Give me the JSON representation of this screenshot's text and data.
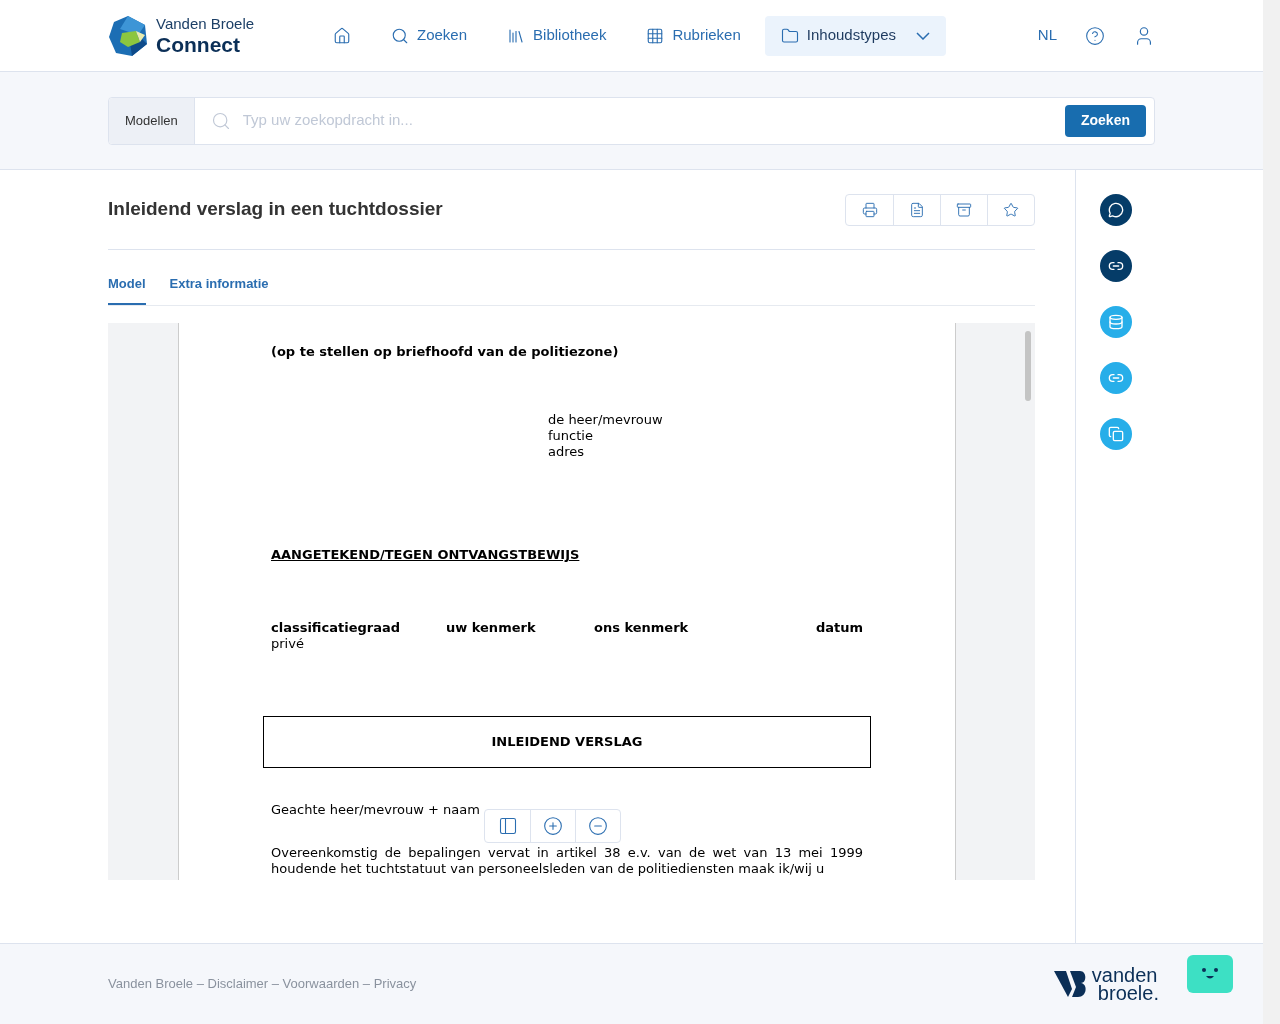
{
  "header": {
    "brand": {
      "line1": "Vanden Broele",
      "line2": "Connect"
    },
    "nav": [
      {
        "kind": "home",
        "selected": false
      },
      {
        "kind": "search",
        "label": "Zoeken",
        "selected": false
      },
      {
        "kind": "library",
        "label": "Bibliotheek",
        "selected": false
      },
      {
        "kind": "grid",
        "label": "Rubrieken",
        "selected": false
      },
      {
        "kind": "folder",
        "label": "Inhoudstypes",
        "selected": true
      }
    ],
    "language": "NL"
  },
  "search": {
    "scope": "Modellen",
    "placeholder": "Typ uw zoekopdracht in...",
    "button": "Zoeken"
  },
  "document": {
    "title": "Inleidend verslag in een tuchtdossier",
    "tabs": [
      {
        "label": "Model",
        "selected": true
      },
      {
        "label": "Extra informatie",
        "selected": false
      }
    ],
    "page": {
      "letterhead": "(op te stellen op briefhoofd van de politiezone)",
      "address": [
        "de heer/mevrouw",
        "functie",
        "adres"
      ],
      "registered": "AANGETEKEND/TEGEN ONTVANGSTBEWIJS",
      "reference_columns": [
        {
          "heading": "classificatiegraad",
          "value": "privé"
        },
        {
          "heading": "uw kenmerk"
        },
        {
          "heading": "ons kenmerk"
        },
        {
          "heading": "datum"
        }
      ],
      "boxed_title": "INLEIDEND VERSLAG",
      "salutation": "Geachte heer/mevrouw + naam",
      "body": "Overeenkomstig de bepalingen vervat in artikel 38 e.v. van de wet van 13 mei 1999 houdende het tuchtstatuut van personeelsleden van de politiediensten maak ik/wij u"
    }
  },
  "side_actions": [
    {
      "kind": "comment",
      "color": "#053c68"
    },
    {
      "kind": "link",
      "color": "#053c68"
    },
    {
      "kind": "database",
      "color": "#27aee9"
    },
    {
      "kind": "link",
      "color": "#27aee9"
    },
    {
      "kind": "copy",
      "color": "#27aee9"
    }
  ],
  "footer": {
    "links": "Vanden Broele – Disclaimer – Voorwaarden – Privacy",
    "logo": {
      "line1": "vanden",
      "line2": "broele."
    }
  }
}
